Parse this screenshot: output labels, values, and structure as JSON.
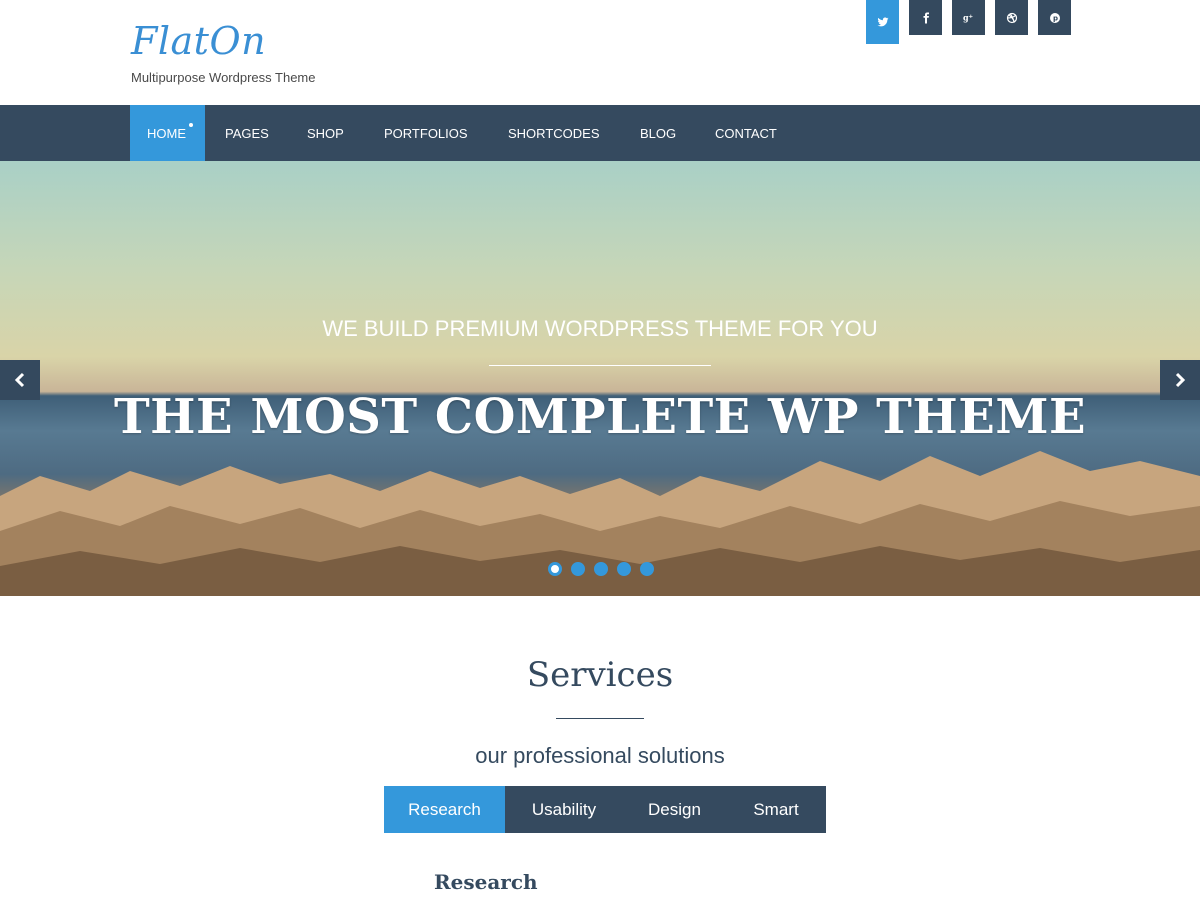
{
  "header": {
    "logo_text": "FlatOn",
    "tagline": "Multipurpose Wordpress Theme",
    "social": [
      {
        "icon": "twitter-icon",
        "glyph": "t"
      },
      {
        "icon": "facebook-icon",
        "glyph": "f"
      },
      {
        "icon": "google-plus-icon",
        "glyph": "g+"
      },
      {
        "icon": "dribbble-icon",
        "glyph": "◎"
      },
      {
        "icon": "pinterest-icon",
        "glyph": "p"
      }
    ]
  },
  "nav": {
    "items": [
      {
        "label": "HOME",
        "active": true
      },
      {
        "label": "PAGES"
      },
      {
        "label": "SHOP"
      },
      {
        "label": "PORTFOLIOS"
      },
      {
        "label": "SHORTCODES"
      },
      {
        "label": "BLOG"
      },
      {
        "label": "CONTACT"
      }
    ]
  },
  "hero": {
    "subtitle": "WE BUILD PREMIUM WORDPRESS THEME FOR YOU",
    "title": "THE MOST COMPLETE WP THEME",
    "slide_count": 5,
    "active_slide": 1
  },
  "services": {
    "title": "Services",
    "subtitle": "our professional solutions",
    "tabs": [
      {
        "label": "Research",
        "active": true
      },
      {
        "label": "Usability"
      },
      {
        "label": "Design"
      },
      {
        "label": "Smart"
      }
    ],
    "content_title": "Research"
  },
  "colors": {
    "accent": "#3498db",
    "dark": "#354a5f"
  }
}
